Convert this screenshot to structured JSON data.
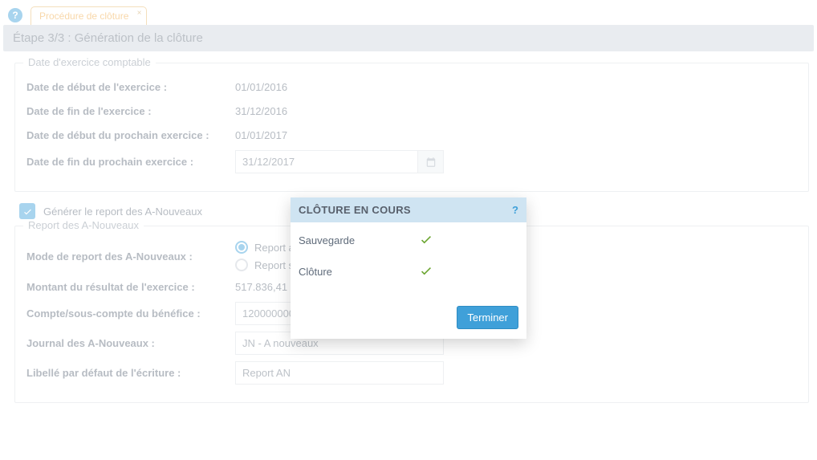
{
  "tab": {
    "label": "Procédure de clôture"
  },
  "step": {
    "title": "Étape 3/3 : Génération de la clôture"
  },
  "exercise": {
    "title": "Date d'exercice comptable",
    "start_label": "Date de début de l'exercice :",
    "start_value": "01/01/2016",
    "end_label": "Date de fin de l'exercice :",
    "end_value": "31/12/2016",
    "next_start_label": "Date de début du prochain exercice :",
    "next_start_value": "01/01/2017",
    "next_end_label": "Date de fin du prochain exercice :",
    "next_end_value": "31/12/2017"
  },
  "generate": {
    "label": "Générer le report des A-Nouveaux",
    "checked": true
  },
  "report": {
    "title": "Report des A-Nouveaux",
    "mode_label": "Mode de report des A-Nouveaux :",
    "mode_option_with": "Report avec",
    "mode_option_without": "Report sans",
    "result_label": "Montant du résultat de l'exercice :",
    "result_value": "517.836,41",
    "account_label": "Compte/sous-compte du bénéfice :",
    "account_value": "12000000000.0",
    "journal_label": "Journal des A-Nouveaux :",
    "journal_value": "JN - A nouveaux",
    "entry_label": "Libellé par défaut de l'écriture :",
    "entry_value": "Report AN"
  },
  "modal": {
    "title": "CLÔTURE EN COURS",
    "rows": [
      {
        "label": "Sauvegarde",
        "done": true
      },
      {
        "label": "Clôture",
        "done": true
      }
    ],
    "finish_label": "Terminer"
  }
}
